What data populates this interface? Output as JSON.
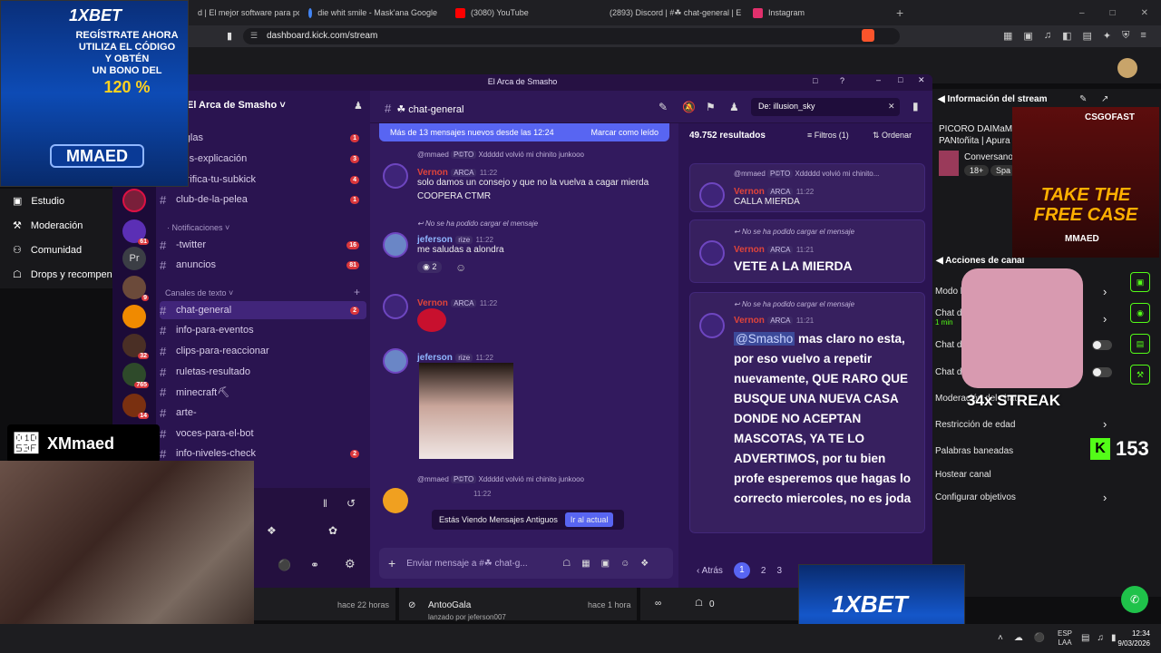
{
  "browser": {
    "tabs": [
      {
        "label": "d | El mejor software para pote",
        "color": "#ffffff"
      },
      {
        "label": "die whit smile - Mask'ana Google",
        "color": "#4285f4"
      },
      {
        "label": "(3080) YouTube",
        "color": "#ff0000"
      },
      {
        "label": "(2893) Discord | #☘ chat-general | E",
        "color": "#5865f2"
      },
      {
        "label": "Instagram",
        "color": "#e1306c"
      }
    ],
    "url": "dashboard.kick.com/stream"
  },
  "ads": {
    "top_left_brand": "1XBET",
    "top_left_lines": [
      "REGÍSTRATE AHORA",
      "UTILIZA EL CÓDIGO",
      "Y OBTÉN",
      "UN BONO DEL",
      "120 %"
    ],
    "top_left_code": "MMAED",
    "xbrand": "XMmaed",
    "bottom_brand": "1XBET",
    "csgo_brand": "CSGOFAST",
    "csgo_line1": "TAKE THE",
    "csgo_line2": "FREE CASE",
    "csgo_code": "MMAED",
    "streak": "34x STREAK",
    "kick_count": "153"
  },
  "kick_nav": {
    "items": [
      "Estudio",
      "Moderación",
      "Comunidad",
      "Drops y recompen"
    ]
  },
  "discord": {
    "window_title": "El Arca de Smasho",
    "server_name": "El Arca de Smasho",
    "channel_header": "☘ chat-general",
    "search_query": "De: illusion_sky",
    "new_messages_banner": "Más de 13 mensajes nuevos desde las 12:24",
    "mark_read": "Marcar como leído",
    "old_messages_notice": "Estás Viendo Mensajes Antiguos",
    "jump_present": "Ir al actual",
    "input_placeholder": "Enviar mensaje a #☘ chat-g...",
    "channels_top": [
      {
        "name": "reglas",
        "count": "1"
      },
      {
        "name": "oles-explicación",
        "count": "3"
      },
      {
        "name": "verifica-tu-subkick",
        "count": "4"
      },
      {
        "name": "club-de-la-pelea",
        "count": "1"
      }
    ],
    "category_notifications": "· Notificaciones",
    "channels_notif": [
      {
        "name": "-twitter",
        "count": "16"
      },
      {
        "name": "anuncios",
        "count": "81"
      }
    ],
    "category_text": "Canales de texto",
    "channels_text": [
      {
        "name": "chat-general",
        "count": "2"
      },
      {
        "name": "info-para-eventos",
        "count": ""
      },
      {
        "name": "clips-para-reaccionar",
        "count": ""
      },
      {
        "name": "ruletas-resultado",
        "count": ""
      },
      {
        "name": "minecraft⛏",
        "count": ""
      },
      {
        "name": "arte-",
        "count": ""
      },
      {
        "name": "voces-para-el-bot",
        "count": ""
      },
      {
        "name": "info-niveles-check",
        "count": "2"
      }
    ],
    "guild_badges": [
      "61",
      "9",
      "32",
      "765",
      "14"
    ],
    "guild_pr": "Pr",
    "messages": [
      {
        "reply_user": "@mmaed",
        "reply_role": "P©TO",
        "reply_text": "Xddddd volvió mi chinito junkooo",
        "user": "Vernon",
        "role": "ARCA",
        "time": "11:22",
        "lines": [
          "solo damos un consejo y que no la vuelva a cagar mierda",
          "COOPERA CTMR"
        ]
      },
      {
        "reply_text": "No se ha podido cargar el mensaje",
        "user": "jeferson",
        "role": "rize",
        "time": "11:22",
        "lines": [
          "me saludas a alondra"
        ],
        "reaction": "2"
      },
      {
        "user": "Vernon",
        "role": "ARCA",
        "time": "11:22",
        "lines": []
      },
      {
        "user": "jeferson",
        "role": "rize",
        "time": "11:22",
        "lines": []
      },
      {
        "reply_user": "@mmaed",
        "reply_role": "P©TO",
        "reply_text": "Xddddd volvió mi chinito junkooo",
        "time": "11:22",
        "lines": []
      }
    ],
    "search": {
      "results": "49.752 resultados",
      "filters": "Filtros (1)",
      "sort": "Ordenar",
      "cards": [
        {
          "reply_user": "@mmaed",
          "reply_role": "P©TO",
          "reply_text": "Xddddd volvió mi chinito...",
          "user": "Vernon",
          "role": "ARCA",
          "time": "11:22",
          "text": "CALLA MIERDA"
        },
        {
          "reply_text": "No se ha podido cargar el mensaje",
          "user": "Vernon",
          "role": "ARCA",
          "time": "11:21",
          "text": "VETE A LA MIERDA"
        },
        {
          "reply_text": "No se ha podido cargar el mensaje",
          "user": "Vernon",
          "role": "ARCA",
          "time": "11:21",
          "mention": "@Smasho",
          "text": "mas claro no esta, por eso vuelvo a repetir nuevamente, QUE RARO QUE BUSQUE UNA NUEVA CASA DONDE NO ACEPTAN MASCOTAS, YA TE LO ADVERTIMOS, por tu bien profe esperemos que hagas lo correcto miercoles, no es joda"
        }
      ],
      "prev": "Atrás",
      "pages": [
        "1",
        "2",
        "3"
      ]
    }
  },
  "stream_info": {
    "title": "Información del stream",
    "stream_line1": "PICORO DAIMaMA",
    "stream_line2": "PANtoñita | Apura",
    "convo": "Conversano",
    "age": "18+",
    "lang": "Spa"
  },
  "channel_actions": {
    "title": "Acciones de canal",
    "items": [
      {
        "label": "Modo lento",
        "sub": ""
      },
      {
        "label": "Chat d",
        "sub": "1 min"
      },
      {
        "label": "Chat d",
        "sub": ""
      },
      {
        "label": "Chat d",
        "sub": ""
      },
      {
        "label": "Moderación del chat",
        "sub": ""
      },
      {
        "label": "Restricción de edad",
        "sub": ""
      },
      {
        "label": "Palabras baneadas",
        "sub": ""
      },
      {
        "label": "Hostear canal",
        "sub": ""
      },
      {
        "label": "Configurar objetivos",
        "sub": ""
      }
    ]
  },
  "kick_bottom": {
    "row1_time": "hace 22 horas",
    "row2_user": "AntooGala",
    "row2_time": "hace 1 hora",
    "row2_sub": "lanzado por jeferson007",
    "counter": "0"
  },
  "taskbar": {
    "lang1": "ESP",
    "lang2": "LAA",
    "time": "12:34",
    "date": "9/03/2026"
  },
  "colors": {
    "discord_bg": "#2b1452",
    "accent": "#5865f2",
    "badge": "#da373c",
    "kick_green": "#53fc18"
  }
}
